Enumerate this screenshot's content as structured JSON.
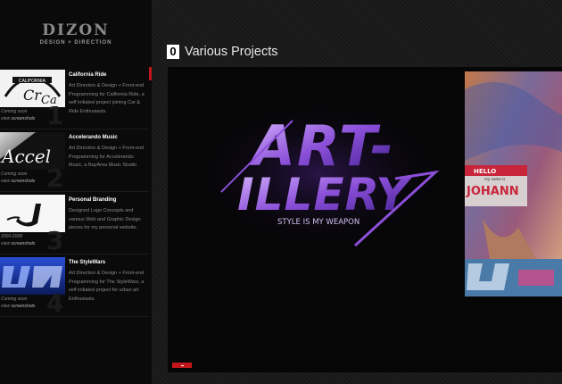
{
  "logo": {
    "main": "DIZON",
    "sub": "DESIGN + DIRECTION"
  },
  "projects": [
    {
      "title": "California Ride",
      "desc": "Art Direction & Design + Front-end Programming for California Ride, a self initiated project joining Car & Ride Enthusiasts.",
      "status": "Coming soon",
      "view": "view",
      "link": "screenshots",
      "num": "1"
    },
    {
      "title": "Accelerando Music",
      "desc": "Art Direction & Design + Front-end Programming for Accelerando Music, a BayArea Music Studio",
      "status": "Coming soon",
      "view": "view",
      "link": "screenshots",
      "num": "2"
    },
    {
      "title": "Personal Branding",
      "desc": "Designed Logo Concepts and various Web and Graphic Design pieces for my personal website.",
      "status": "2000-2008",
      "view": "view",
      "link": "screenshots",
      "num": "3"
    },
    {
      "title": "The StyleWars",
      "desc": "Art Direction & Design + Front-end Programming for The StyleWars, a self initiated project for urban art Enthusiasts.",
      "status": "Coming soon",
      "view": "view",
      "link": "screenshots",
      "num": "4"
    }
  ],
  "main": {
    "section_number": "0",
    "section_title": "Various Projects",
    "slide": {
      "art_line1": "ART-",
      "art_line2": "ILLERY",
      "tagline": "STYLE IS MY WEAPON"
    },
    "next_slide": {
      "sticker_top": "HELLO",
      "sticker_mid": "my name is",
      "sticker_name": "JOHANN"
    }
  },
  "colors": {
    "accent": "#c3161c",
    "background": "#0b0b0b",
    "purple": "#8b4fd8"
  }
}
